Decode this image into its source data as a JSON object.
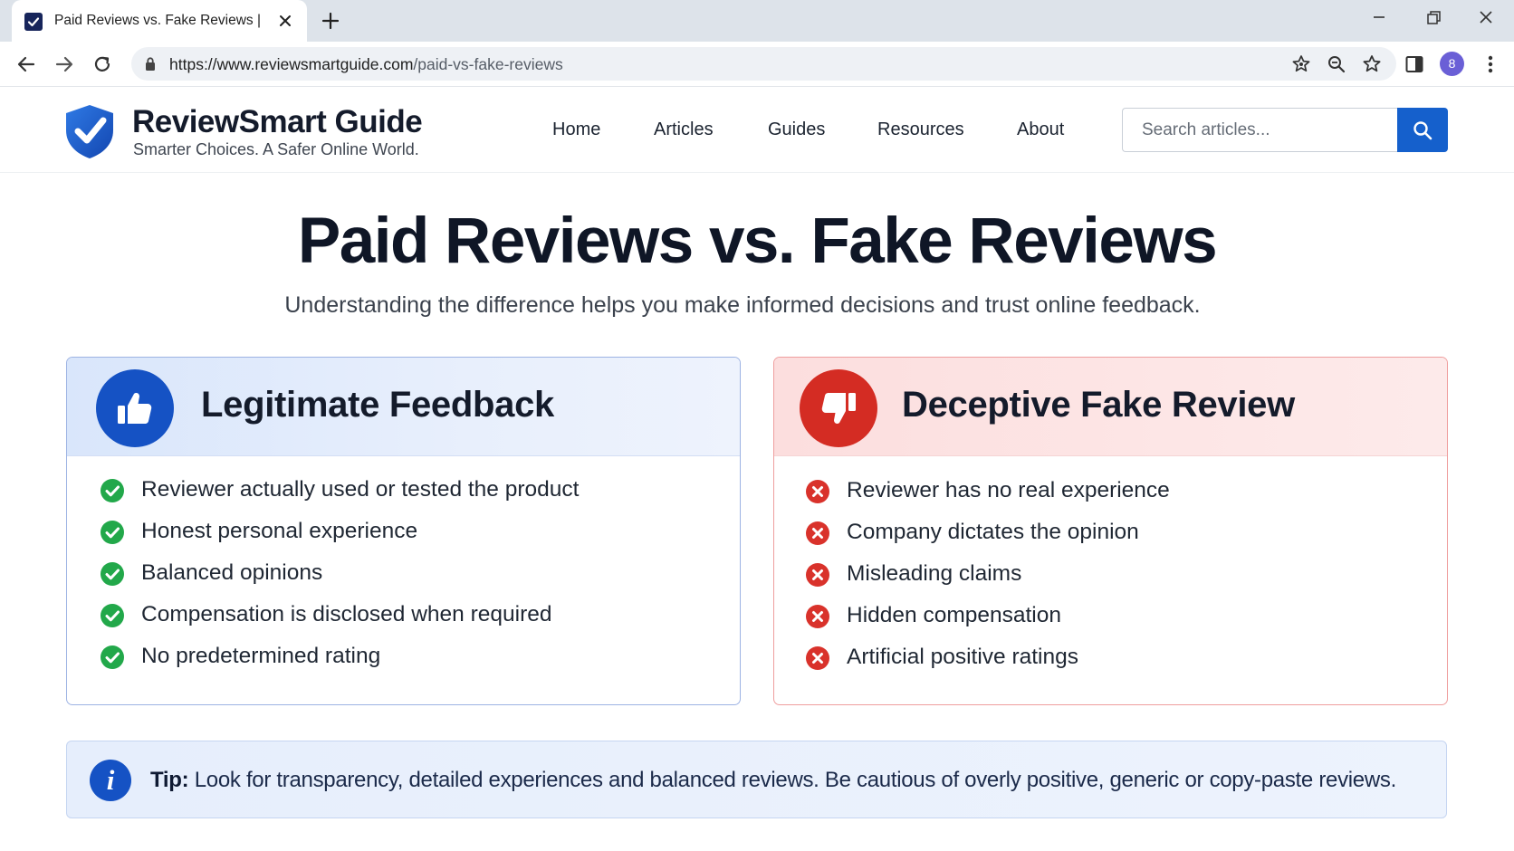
{
  "browser": {
    "tab_title": "Paid Reviews vs. Fake Reviews |",
    "url_host": "https://www.reviewsmartguide.com",
    "url_path": "/paid-vs-fake-reviews",
    "profile_initial": "8"
  },
  "site": {
    "brand_name": "ReviewSmart Guide",
    "tagline": "Smarter Choices. A Safer Online World.",
    "nav": [
      "Home",
      "Articles",
      "Guides",
      "Resources",
      "About"
    ],
    "search_placeholder": "Search articles..."
  },
  "hero": {
    "title": "Paid Reviews vs. Fake Reviews",
    "subtitle": "Understanding the difference helps you make informed decisions and trust online feedback."
  },
  "cards": {
    "legitimate": {
      "title": "Legitimate Feedback",
      "icon": "thumbs-up-icon",
      "items": [
        "Reviewer actually used or tested the product",
        "Honest personal experience",
        "Balanced opinions",
        "Compensation is disclosed when required",
        "No predetermined rating"
      ]
    },
    "fake": {
      "title": "Deceptive Fake Review",
      "icon": "thumbs-down-icon",
      "items": [
        "Reviewer has no real experience",
        "Company dictates the opinion",
        "Misleading claims",
        "Hidden compensation",
        "Artificial positive ratings"
      ]
    }
  },
  "tip": {
    "label": "Tip:",
    "text": " Look for transparency, detailed experiences and balanced reviews. Be cautious of overly positive, generic or copy-paste reviews."
  },
  "colors": {
    "accent_blue": "#1552c4",
    "accent_red": "#d42c23",
    "check_green": "#22a84a",
    "search_button": "#1560cc"
  }
}
